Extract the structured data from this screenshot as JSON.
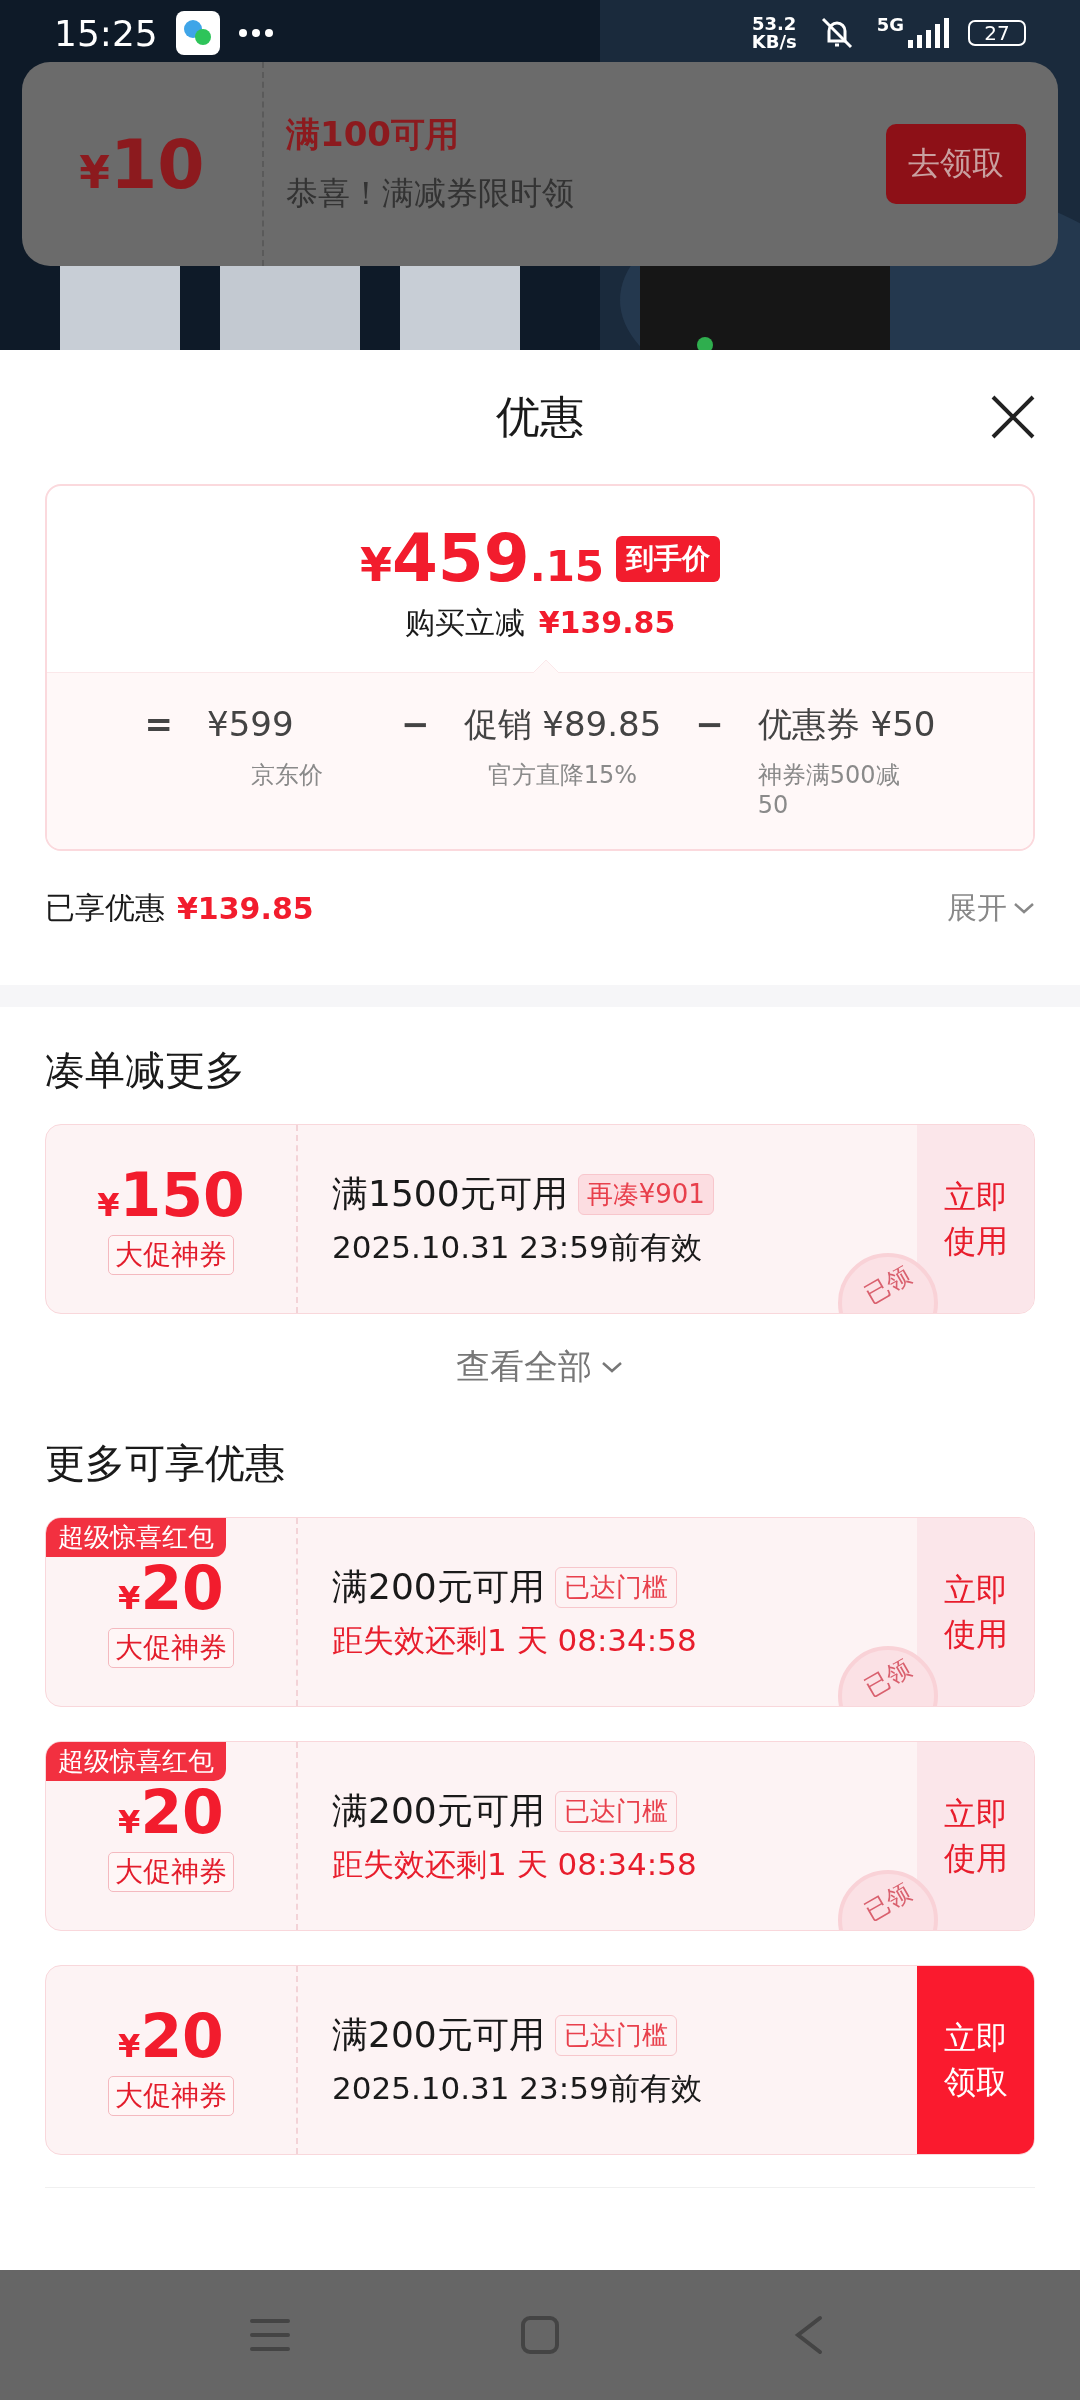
{
  "status_bar": {
    "time": "15:25",
    "network_speed": "53.2",
    "network_unit": "KB/s",
    "network_type": "5G",
    "battery": "27"
  },
  "banner": {
    "symbol": "¥",
    "amount": "10",
    "condition": "满100可用",
    "message": "恭喜！满减券限时领",
    "button": "去领取"
  },
  "sheet": {
    "title": "优惠"
  },
  "price_card": {
    "symbol": "¥",
    "price_int": "459",
    "price_dec": ".15",
    "price_tag": "到手价",
    "saving_label": "购买立减",
    "saving_amount": "¥139.85",
    "breakdown": [
      {
        "operator": "=",
        "value": "¥599",
        "note": "京东价"
      },
      {
        "operator": "−",
        "value": "促销 ¥89.85",
        "note": "官方直降15%"
      },
      {
        "operator": "−",
        "value": "优惠券 ¥50",
        "note": "神券满500减50"
      }
    ]
  },
  "enjoyed": {
    "label": "已享优惠",
    "amount": "¥139.85",
    "expand": "展开"
  },
  "sections": [
    {
      "title": "凑单减更多",
      "view_all": "查看全部",
      "coupons": [
        {
          "symbol": "¥",
          "amount": "150",
          "tag": "大促神券",
          "condition": "满1500元可用",
          "badge": {
            "text": "再凑¥901",
            "kind": "filled"
          },
          "validity": {
            "text": "2025.10.31 23:59前有效",
            "kind": "date"
          },
          "stamp": "已领",
          "action": "立即使用",
          "claimed": true
        }
      ]
    },
    {
      "title": "更多可享优惠",
      "coupons": [
        {
          "ribbon": "超级惊喜红包",
          "symbol": "¥",
          "amount": "20",
          "tag": "大促神券",
          "condition": "满200元可用",
          "badge": {
            "text": "已达门槛",
            "kind": "outline"
          },
          "validity": {
            "text": "距失效还剩1 天 08:34:58",
            "kind": "countdown"
          },
          "stamp": "已领",
          "action": "立即使用",
          "claimed": true
        },
        {
          "ribbon": "超级惊喜红包",
          "symbol": "¥",
          "amount": "20",
          "tag": "大促神券",
          "condition": "满200元可用",
          "badge": {
            "text": "已达门槛",
            "kind": "outline"
          },
          "validity": {
            "text": "距失效还剩1 天 08:34:58",
            "kind": "countdown"
          },
          "stamp": "已领",
          "action": "立即使用",
          "claimed": true
        },
        {
          "symbol": "¥",
          "amount": "20",
          "tag": "大促神券",
          "condition": "满200元可用",
          "badge": {
            "text": "已达门槛",
            "kind": "outline"
          },
          "validity": {
            "text": "2025.10.31 23:59前有效",
            "kind": "date"
          },
          "action": "立即领取",
          "claimed": false
        }
      ]
    }
  ]
}
